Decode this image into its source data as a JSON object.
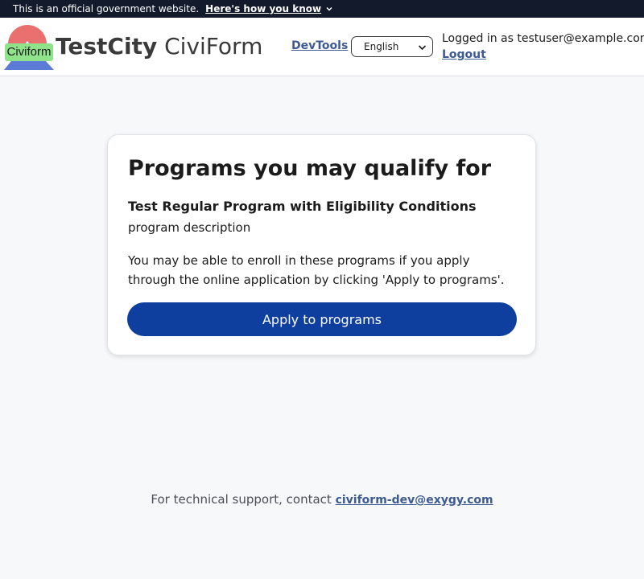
{
  "gov_banner": {
    "text": "This is an official government website.",
    "link_label": "Here's how you know"
  },
  "header": {
    "logo_badge": "Civiform",
    "title_city": "TestCity",
    "title_app": "CiviForm",
    "devtools_label": "DevTools",
    "language": {
      "selected": "English"
    },
    "user": {
      "logged_in_text": "Logged in as testuser@example.com",
      "logout_label": "Logout"
    }
  },
  "card": {
    "heading": "Programs you may qualify for",
    "program_name": "Test Regular Program with Eligibility Conditions",
    "program_description": "program description",
    "enroll_text": "You may be able to enroll in these programs if you apply through the online application by clicking 'Apply to programs'.",
    "apply_label": "Apply to programs"
  },
  "footer": {
    "support_text": "For technical support, contact ",
    "support_email": "civiform-dev@exygy.com"
  },
  "colors": {
    "banner_bg": "#121a2b",
    "primary_button": "#0f3f9e",
    "link": "#3d5a93",
    "logo_badge": "#8fe38b",
    "page_bg": "#f7f8fa"
  }
}
